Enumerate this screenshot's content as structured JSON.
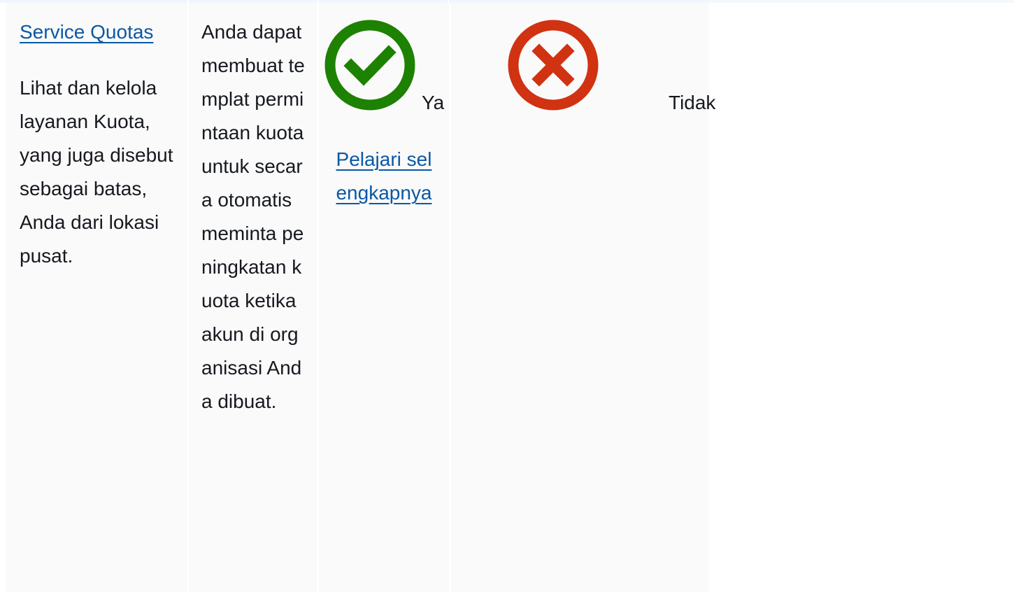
{
  "row": {
    "service": {
      "link_label": "Service Quotas",
      "description": "Lihat dan kelola layanan Kuota, yang juga disebut sebagai batas, Anda dari lokasi pusat."
    },
    "feature_description": "Anda dapat membuat templat permintaan kuota untuk secara otomatis meminta peningkatan kuota ketika akun di organisasi Anda dibuat.",
    "supported": {
      "icon": "check-circle-icon",
      "label": "Ya",
      "learn_more": "Pelajari selengkapnya"
    },
    "not_supported": {
      "icon": "x-circle-icon",
      "label": "Tidak"
    }
  },
  "colors": {
    "link": "#0a58a5",
    "success": "#1d8102",
    "error": "#d13212",
    "cell_bg": "#fafafa"
  }
}
